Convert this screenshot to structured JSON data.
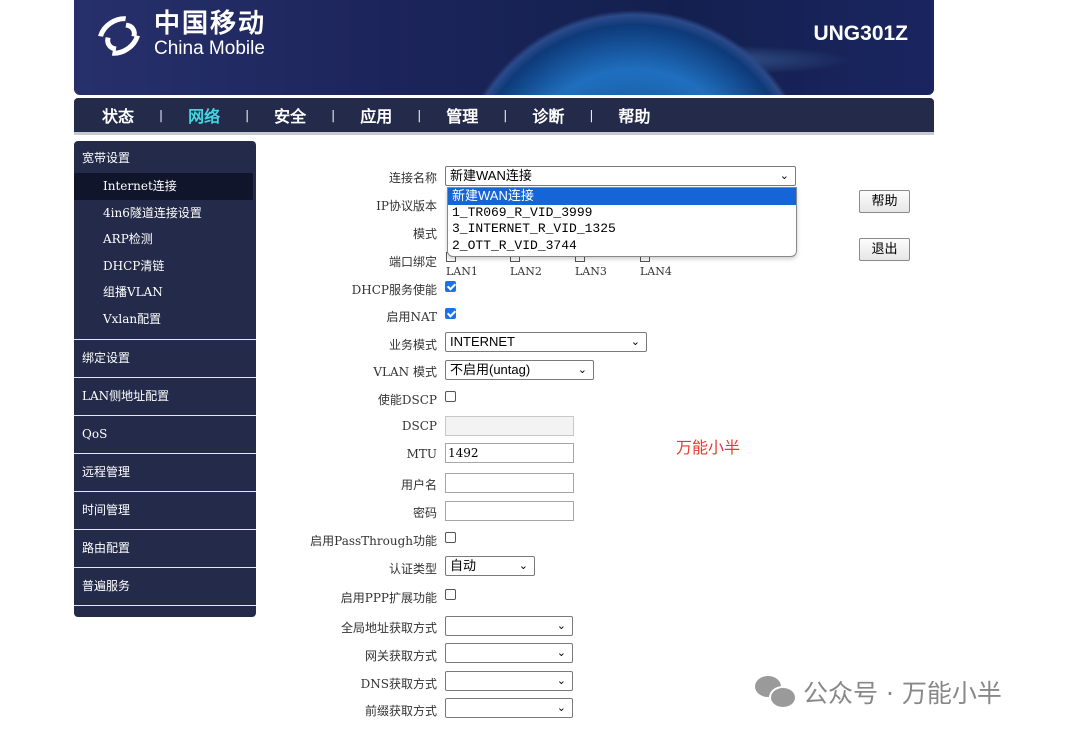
{
  "header": {
    "logo_cn": "中国移动",
    "logo_en": "China Mobile",
    "model": "UNG301Z"
  },
  "nav": {
    "items": [
      {
        "label": "状态"
      },
      {
        "label": "网络",
        "active": true
      },
      {
        "label": "安全"
      },
      {
        "label": "应用"
      },
      {
        "label": "管理"
      },
      {
        "label": "诊断"
      },
      {
        "label": "帮助"
      }
    ],
    "separator": "|"
  },
  "sidebar": {
    "section_title": "宽带设置",
    "subitems": [
      "Internet连接",
      "4in6隧道连接设置",
      "ARP检测",
      "DHCP清链",
      "组播VLAN",
      "Vxlan配置"
    ],
    "groups": [
      "绑定设置",
      "LAN侧地址配置",
      "QoS",
      "远程管理",
      "时间管理",
      "路由配置",
      "普遍服务"
    ]
  },
  "form": {
    "connection_name": {
      "label": "连接名称",
      "value": "新建WAN连接"
    },
    "connection_options": [
      "新建WAN连接",
      "1_TR069_R_VID_3999",
      "3_INTERNET_R_VID_1325",
      "2_OTT_R_VID_3744"
    ],
    "ip_version": {
      "label": "IP协议版本"
    },
    "mode": {
      "label": "模式"
    },
    "port_binding": {
      "label": "端口绑定",
      "ports": [
        "LAN1",
        "LAN2",
        "LAN3",
        "LAN4"
      ]
    },
    "dhcp_enable": {
      "label": "DHCP服务使能",
      "checked": true
    },
    "nat_enable": {
      "label": "启用NAT",
      "checked": true
    },
    "service_mode": {
      "label": "业务模式",
      "value": "INTERNET"
    },
    "vlan_mode": {
      "label": "VLAN 模式",
      "value": "不启用(untag)"
    },
    "dscp_enable": {
      "label": "使能DSCP",
      "checked": false
    },
    "dscp": {
      "label": "DSCP",
      "value": ""
    },
    "mtu": {
      "label": "MTU",
      "value": "1492"
    },
    "username": {
      "label": "用户名",
      "value": ""
    },
    "password": {
      "label": "密码",
      "value": ""
    },
    "passthrough": {
      "label": "启用PassThrough功能",
      "checked": false
    },
    "auth_type": {
      "label": "认证类型",
      "value": "自动"
    },
    "ppp_ext": {
      "label": "启用PPP扩展功能",
      "checked": false
    },
    "global_addr": {
      "label": "全局地址获取方式",
      "value": ""
    },
    "gateway": {
      "label": "网关获取方式",
      "value": ""
    },
    "dns": {
      "label": "DNS获取方式",
      "value": ""
    },
    "prefix": {
      "label": "前缀获取方式",
      "value": ""
    }
  },
  "buttons": {
    "help": "帮助",
    "logout": "退出"
  },
  "watermarks": {
    "red": "万能小半",
    "wechat": "公众号 · 万能小半"
  },
  "colors": {
    "nav_bg": "#232a4a",
    "nav_active": "#3fd6e0",
    "highlight": "#1565d8",
    "red": "#e83b2e"
  }
}
